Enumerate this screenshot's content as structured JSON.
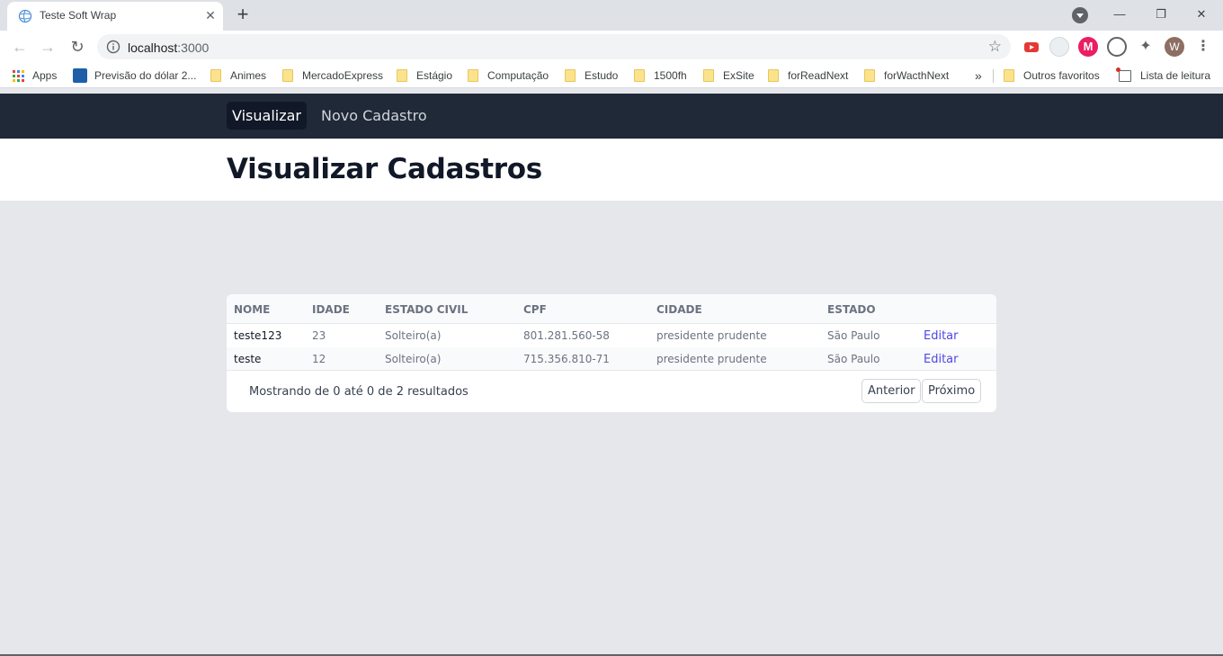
{
  "browser": {
    "tab_title": "Teste Soft Wrap",
    "url_host": "localhost",
    "url_port": ":3000",
    "profile_initial": "W",
    "bookmarks": [
      {
        "label": "Apps",
        "icon": "apps-grid-icon"
      },
      {
        "label": "Previsão do dólar 2...",
        "icon": "site-favicon-icon"
      },
      {
        "label": "Animes",
        "icon": "folder-icon"
      },
      {
        "label": "MercadoExpress",
        "icon": "folder-icon"
      },
      {
        "label": "Estágio",
        "icon": "folder-icon"
      },
      {
        "label": "Computação",
        "icon": "folder-icon"
      },
      {
        "label": "Estudo",
        "icon": "folder-icon"
      },
      {
        "label": "1500fh",
        "icon": "folder-icon"
      },
      {
        "label": "ExSite",
        "icon": "folder-icon"
      },
      {
        "label": "forReadNext",
        "icon": "folder-icon"
      },
      {
        "label": "forWacthNext",
        "icon": "folder-icon"
      },
      {
        "label": "»",
        "icon": "overflow-chevron-icon"
      },
      {
        "label": "Outros favoritos",
        "icon": "folder-icon"
      },
      {
        "label": "Lista de leitura",
        "icon": "reading-list-icon"
      }
    ]
  },
  "nav": {
    "items": [
      {
        "label": "Visualizar",
        "active": true
      },
      {
        "label": "Novo Cadastro",
        "active": false
      }
    ]
  },
  "header": {
    "title": "Visualizar Cadastros"
  },
  "table": {
    "columns": [
      "NOME",
      "IDADE",
      "ESTADO CIVIL",
      "CPF",
      "CIDADE",
      "ESTADO"
    ],
    "rows": [
      {
        "nome": "teste123",
        "idade": "23",
        "estado_civil": "Solteiro(a)",
        "cpf": "801.281.560-58",
        "cidade": "presidente prudente",
        "estado": "São Paulo",
        "action": "Editar"
      },
      {
        "nome": "teste",
        "idade": "12",
        "estado_civil": "Solteiro(a)",
        "cpf": "715.356.810-71",
        "cidade": "presidente prudente",
        "estado": "São Paulo",
        "action": "Editar"
      }
    ],
    "footer_text": "Mostrando de 0 até 0 de 2 resultados",
    "prev_label": "Anterior",
    "next_label": "Próximo"
  },
  "colors": {
    "nav_bg": "#1f2937",
    "nav_active_bg": "#111827",
    "page_bg": "#e5e7eb",
    "link": "#4f46e5"
  }
}
